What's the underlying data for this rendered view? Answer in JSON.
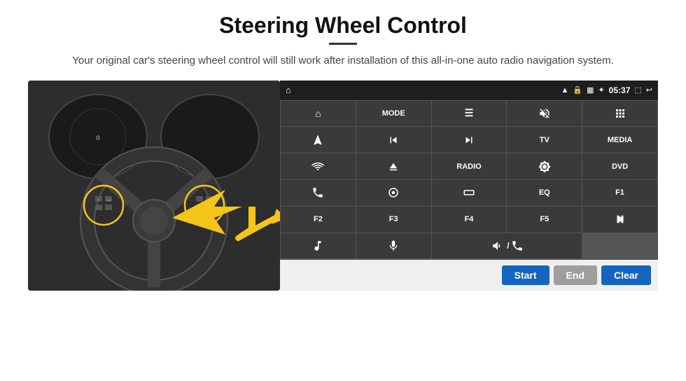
{
  "header": {
    "title": "Steering Wheel Control",
    "subtitle": "Your original car's steering wheel control will still work after installation of this all-in-one auto radio navigation system."
  },
  "status_bar": {
    "time": "05:37",
    "icons": [
      "wifi",
      "lock",
      "sim",
      "bluetooth",
      "cast",
      "back"
    ]
  },
  "button_grid": [
    {
      "id": "home",
      "label": "",
      "icon": "home",
      "row": 1,
      "col": 1
    },
    {
      "id": "mode",
      "label": "MODE",
      "icon": "",
      "row": 1,
      "col": 2
    },
    {
      "id": "list",
      "label": "",
      "icon": "list",
      "row": 1,
      "col": 3
    },
    {
      "id": "mute",
      "label": "",
      "icon": "mute",
      "row": 1,
      "col": 4
    },
    {
      "id": "apps",
      "label": "",
      "icon": "apps",
      "row": 1,
      "col": 5
    },
    {
      "id": "nav",
      "label": "",
      "icon": "nav",
      "row": 2,
      "col": 1
    },
    {
      "id": "prev",
      "label": "",
      "icon": "prev",
      "row": 2,
      "col": 2
    },
    {
      "id": "next",
      "label": "",
      "icon": "next",
      "row": 2,
      "col": 3
    },
    {
      "id": "tv",
      "label": "TV",
      "icon": "",
      "row": 2,
      "col": 4
    },
    {
      "id": "media",
      "label": "MEDIA",
      "icon": "",
      "row": 2,
      "col": 5
    },
    {
      "id": "cam",
      "label": "",
      "icon": "360",
      "row": 3,
      "col": 1
    },
    {
      "id": "eject",
      "label": "",
      "icon": "eject",
      "row": 3,
      "col": 2
    },
    {
      "id": "radio",
      "label": "RADIO",
      "icon": "",
      "row": 3,
      "col": 3
    },
    {
      "id": "bright",
      "label": "",
      "icon": "bright",
      "row": 3,
      "col": 4
    },
    {
      "id": "dvd",
      "label": "DVD",
      "icon": "",
      "row": 3,
      "col": 5
    },
    {
      "id": "phone",
      "label": "",
      "icon": "phone",
      "row": 4,
      "col": 1
    },
    {
      "id": "swipe",
      "label": "",
      "icon": "swipe",
      "row": 4,
      "col": 2
    },
    {
      "id": "rect",
      "label": "",
      "icon": "rect",
      "row": 4,
      "col": 3
    },
    {
      "id": "eq",
      "label": "EQ",
      "icon": "",
      "row": 4,
      "col": 4
    },
    {
      "id": "f1",
      "label": "F1",
      "icon": "",
      "row": 4,
      "col": 5
    },
    {
      "id": "f2",
      "label": "F2",
      "icon": "",
      "row": 5,
      "col": 1
    },
    {
      "id": "f3",
      "label": "F3",
      "icon": "",
      "row": 5,
      "col": 2
    },
    {
      "id": "f4",
      "label": "F4",
      "icon": "",
      "row": 5,
      "col": 3
    },
    {
      "id": "f5",
      "label": "F5",
      "icon": "",
      "row": 5,
      "col": 4
    },
    {
      "id": "play",
      "label": "",
      "icon": "play",
      "row": 5,
      "col": 5
    },
    {
      "id": "music",
      "label": "",
      "icon": "music",
      "row": 6,
      "col": 1
    },
    {
      "id": "mic",
      "label": "",
      "icon": "mic",
      "row": 6,
      "col": 2
    },
    {
      "id": "volhang",
      "label": "",
      "icon": "vol",
      "row": 6,
      "col": 3,
      "span": 2
    }
  ],
  "action_bar": {
    "start_label": "Start",
    "end_label": "End",
    "clear_label": "Clear"
  }
}
